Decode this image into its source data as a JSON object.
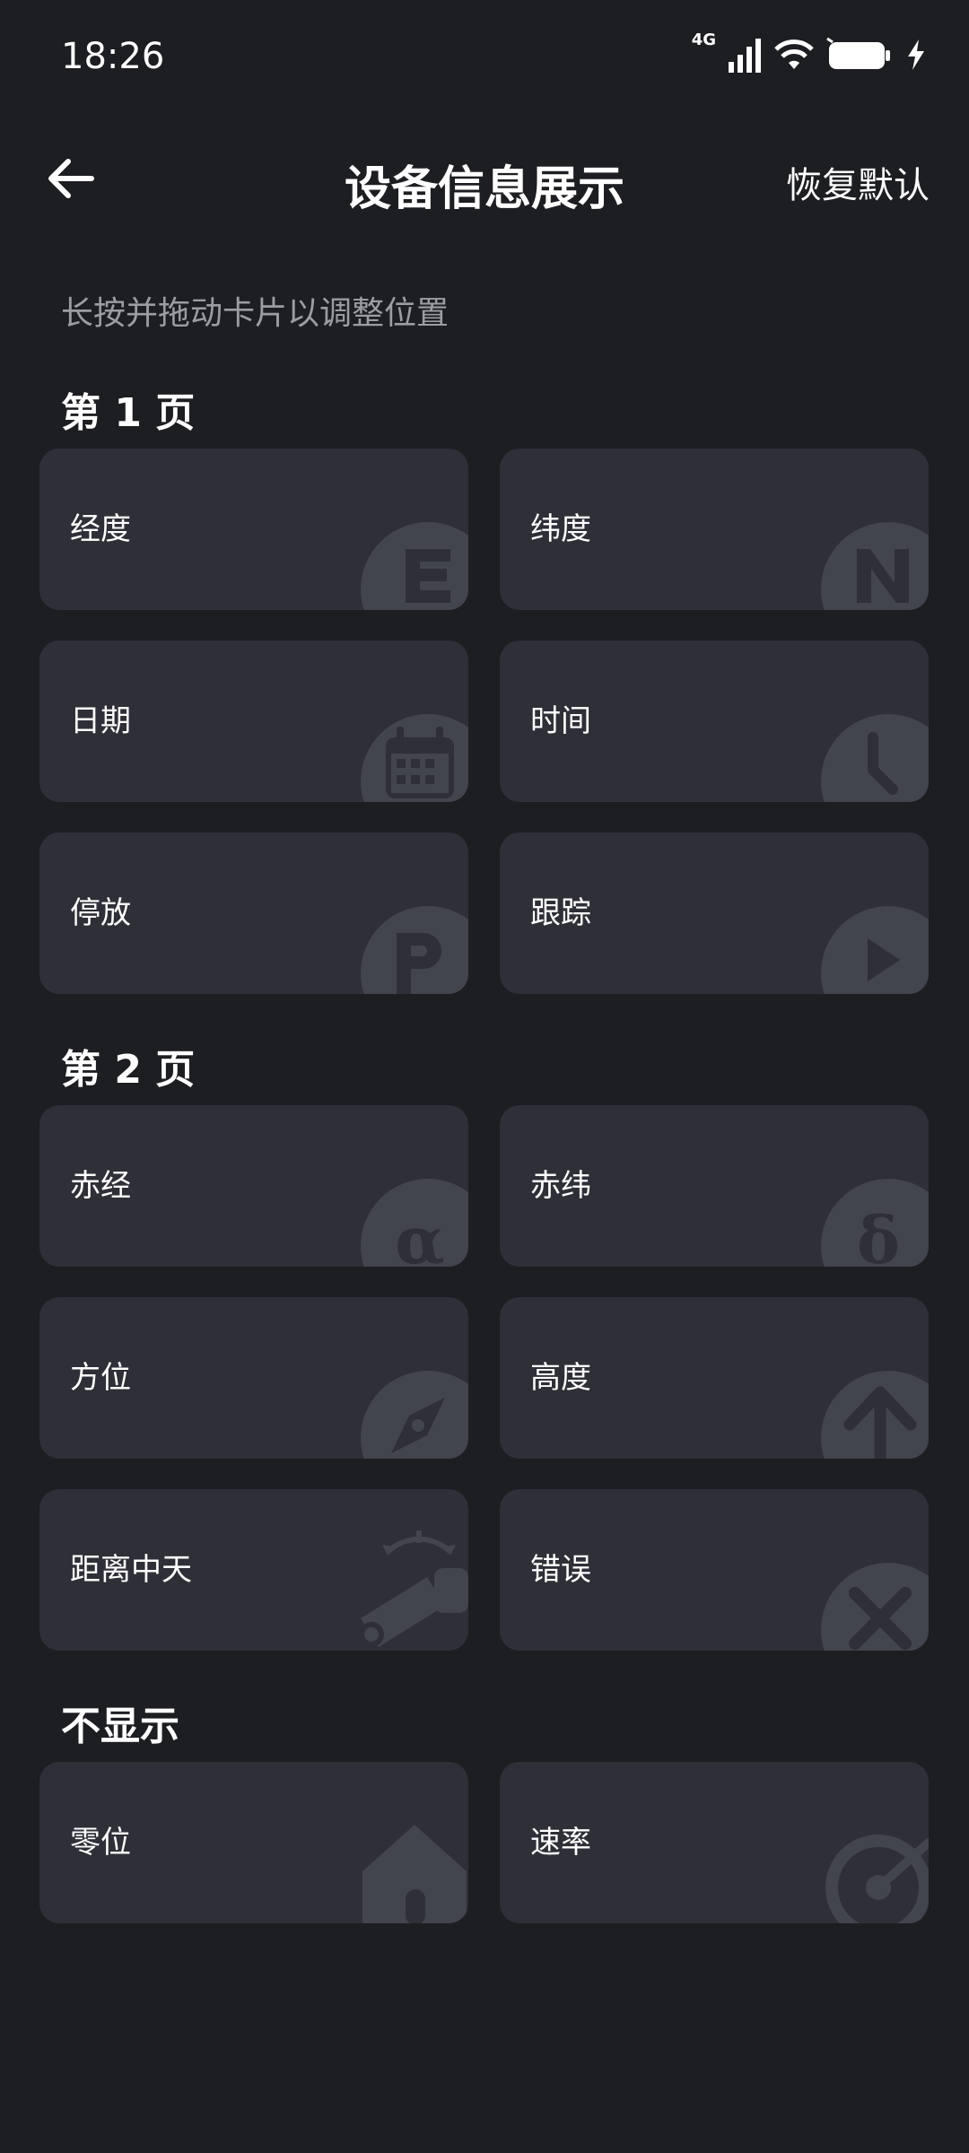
{
  "status": {
    "time": "18:26",
    "network": "4G"
  },
  "header": {
    "title": "设备信息展示",
    "reset_label": "恢复默认"
  },
  "hint": "长按并拖动卡片以调整位置",
  "sections": [
    {
      "title": "第 1 页",
      "items": [
        {
          "label": "经度",
          "icon": "e-letter-icon"
        },
        {
          "label": "纬度",
          "icon": "n-letter-icon"
        },
        {
          "label": "日期",
          "icon": "calendar-icon"
        },
        {
          "label": "时间",
          "icon": "clock-icon"
        },
        {
          "label": "停放",
          "icon": "parking-icon"
        },
        {
          "label": "跟踪",
          "icon": "play-icon"
        }
      ]
    },
    {
      "title": "第 2 页",
      "items": [
        {
          "label": "赤经",
          "icon": "alpha-icon"
        },
        {
          "label": "赤纬",
          "icon": "delta-icon"
        },
        {
          "label": "方位",
          "icon": "compass-icon"
        },
        {
          "label": "高度",
          "icon": "arrow-up-icon"
        },
        {
          "label": "距离中天",
          "icon": "telescope-icon"
        },
        {
          "label": "错误",
          "icon": "close-x-icon"
        }
      ]
    },
    {
      "title": "不显示",
      "items": [
        {
          "label": "零位",
          "icon": "home-icon"
        },
        {
          "label": "速率",
          "icon": "speedometer-icon"
        }
      ]
    }
  ],
  "colors": {
    "background": "#1d1e22",
    "card": "#2e2f37",
    "badge": "#42444e",
    "glyph": "#2e2f37",
    "hint": "#9c9da3"
  }
}
